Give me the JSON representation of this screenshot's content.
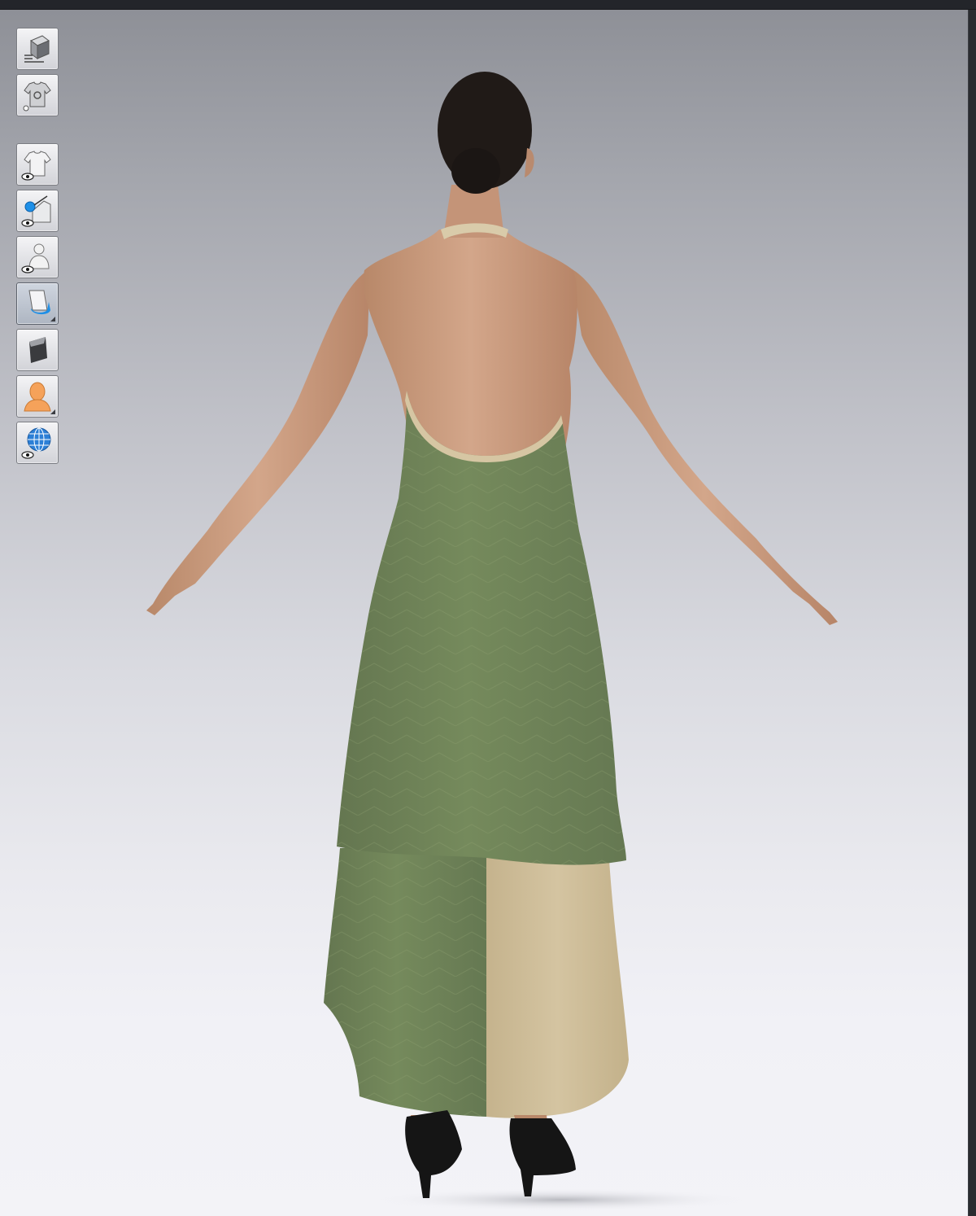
{
  "window": {
    "title": ""
  },
  "toolbar": {
    "buttons": [
      {
        "name": "simulation-cube-button",
        "icon": "cube-icon"
      },
      {
        "name": "garment-settings-button",
        "icon": "shirt-gear-icon"
      },
      {
        "name": "show-garment-button",
        "icon": "shirt-eye-icon"
      },
      {
        "name": "show-pins-button",
        "icon": "pin-eye-icon"
      },
      {
        "name": "show-avatar-button",
        "icon": "avatar-eye-icon"
      },
      {
        "name": "texture-mode-button",
        "icon": "fabric-roll-icon",
        "active": true
      },
      {
        "name": "render-mode-button",
        "icon": "fabric-shade-icon"
      },
      {
        "name": "avatar-skin-button",
        "icon": "avatar-bust-icon"
      },
      {
        "name": "show-environment-button",
        "icon": "globe-eye-icon"
      }
    ]
  },
  "colors": {
    "dress_green": "#6f8357",
    "dress_green_dark": "#5e7049",
    "underskirt_beige": "#cdbc97",
    "skin": "#c89a7e",
    "hair": "#1f1a17",
    "shoes": "#141414"
  }
}
